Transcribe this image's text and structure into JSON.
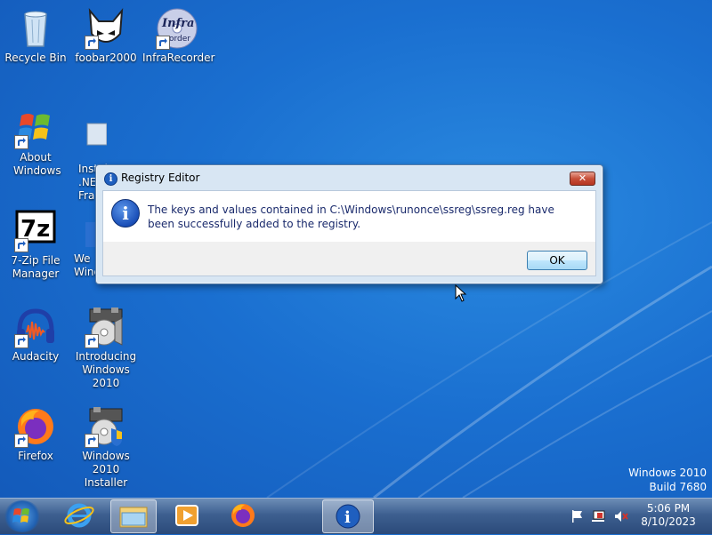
{
  "desktop": {
    "icons": [
      {
        "label": "Recycle Bin"
      },
      {
        "label": "foobar2000"
      },
      {
        "label": "InfraRecorder",
        "logo_text_1": "Infra",
        "logo_text_2": "corder"
      },
      {
        "label": "About Windows"
      },
      {
        "label": "Install .NET Fra"
      },
      {
        "label": "7-Zip File Manager",
        "logo_text": "7z"
      },
      {
        "label": "We Wind"
      },
      {
        "label": "Audacity"
      },
      {
        "label": "Introducing Windows 2010"
      },
      {
        "label": "Firefox"
      },
      {
        "label": "Windows 2010 Installer"
      }
    ]
  },
  "dialog": {
    "title": "Registry Editor",
    "close_label": "✕",
    "message": "The keys and values contained in C:\\Windows\\runonce\\ssreg\\ssreg.reg have been successfully added to the registry.",
    "ok_label": "OK",
    "icon": "information-icon"
  },
  "watermark": {
    "line1": "Windows 2010",
    "line2": "Build 7680"
  },
  "taskbar": {
    "items": [
      "start-button",
      "internet-explorer-icon",
      "file-explorer-icon",
      "media-player-icon",
      "firefox-icon",
      "registry-info-icon"
    ],
    "clock": {
      "time": "5:06 PM",
      "date": "8/10/2023"
    },
    "tray_icons": [
      "flag-icon",
      "network-icon",
      "volume-muted-icon"
    ]
  },
  "colors": {
    "wallpaper": "#1a6fd0",
    "taskbar": "#3d5f90",
    "dialog_frame": "#d8e6f3"
  }
}
